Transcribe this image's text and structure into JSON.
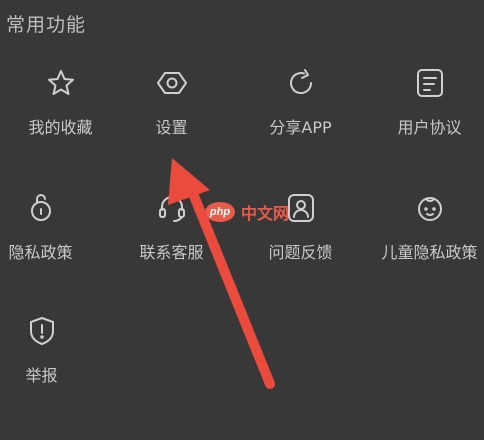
{
  "section": {
    "title": "常用功能"
  },
  "items": [
    {
      "label": "我的收藏",
      "icon": "star-icon"
    },
    {
      "label": "设置",
      "icon": "settings-hexagon-icon"
    },
    {
      "label": "分享APP",
      "icon": "share-refresh-icon"
    },
    {
      "label": "用户协议",
      "icon": "document-icon"
    },
    {
      "label": "隐私政策",
      "icon": "lock-icon"
    },
    {
      "label": "联系客服",
      "icon": "headset-icon"
    },
    {
      "label": "问题反馈",
      "icon": "person-frame-icon"
    },
    {
      "label": "儿童隐私政策",
      "icon": "child-face-icon"
    },
    {
      "label": "举报",
      "icon": "shield-icon"
    }
  ],
  "watermark": {
    "logo_text": "php",
    "text": "中文网"
  },
  "colors": {
    "background": "#383838",
    "icon": "#cfcfcf",
    "label": "#c8c8c8",
    "arrow": "#ea4b3c"
  }
}
